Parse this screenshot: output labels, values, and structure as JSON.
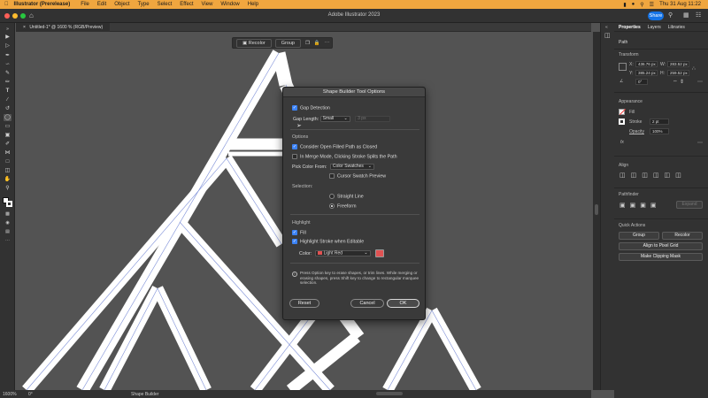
{
  "menubar": {
    "app_name": "Illustrator (Prerelease)",
    "items": [
      "File",
      "Edit",
      "Object",
      "Type",
      "Select",
      "Effect",
      "View",
      "Window",
      "Help"
    ],
    "datetime": "Thu 31 Aug  11:22"
  },
  "window": {
    "title": "Adobe Illustrator 2023",
    "share_label": "Share"
  },
  "document_tab": {
    "label": "Untitled-1* @ 1600 % (RGB/Preview)"
  },
  "context_bar": {
    "recolor_label": "Recolor",
    "group_label": "Group"
  },
  "status_bar": {
    "zoom": "1600%",
    "rotation": "0°",
    "tool": "Shape Builder"
  },
  "right_panel": {
    "tabs": [
      "Properties",
      "Layers",
      "Libraries"
    ],
    "selection_type": "Path",
    "transform": {
      "title": "Transform",
      "x_label": "X:",
      "x": "436.76 px",
      "y_label": "Y:",
      "y": "385.24 px",
      "w_label": "W:",
      "w": "283.52 px",
      "h_label": "H:",
      "h": "259.52 px",
      "angle": "0°"
    },
    "appearance": {
      "title": "Appearance",
      "fill_label": "Fill",
      "stroke_label": "Stroke",
      "stroke_weight": "2 pt",
      "opacity_label": "Opacity",
      "opacity_value": "100%",
      "fx_label": "fx"
    },
    "align": {
      "title": "Align"
    },
    "pathfinder": {
      "title": "Pathfinder",
      "expand_label": "Expand"
    },
    "quick_actions": {
      "title": "Quick Actions",
      "group_label": "Group",
      "recolor_label": "Recolor",
      "align_pixel_label": "Align to Pixel Grid",
      "clipping_mask_label": "Make Clipping Mask"
    }
  },
  "dialog": {
    "title": "Shape Builder Tool Options",
    "gap_detection_label": "Gap Detection",
    "gap_detection_checked": true,
    "gap_length_label": "Gap Length:",
    "gap_length_value": "Small",
    "gap_length_field": "3 px",
    "options_heading": "Options",
    "consider_open_label": "Consider Open Filled Path as Closed",
    "consider_open_checked": true,
    "merge_mode_label": "In Merge Mode, Clicking Stroke Splits the Path",
    "merge_mode_checked": false,
    "pick_color_label": "Pick Color From:",
    "pick_color_value": "Color Swatches",
    "cursor_preview_label": "Cursor Swatch Preview",
    "cursor_preview_checked": false,
    "selection_heading": "Selection:",
    "straight_line_label": "Straight Line",
    "freeform_label": "Freeform",
    "selection_value": "Freeform",
    "highlight_heading": "Highlight",
    "fill_label": "Fill",
    "fill_checked": true,
    "highlight_stroke_label": "Highlight Stroke when Editable",
    "highlight_stroke_checked": true,
    "color_label": "Color:",
    "color_value": "Light Red",
    "highlight_color": "#e05252",
    "info_text": "Press Option key to erase shapes, or trim lines. While merging or erasing shapes, press Shift key to change to rectangular marquee selection.",
    "reset_label": "Reset",
    "cancel_label": "Cancel",
    "ok_label": "OK"
  },
  "colors": {
    "menubar": "#f0a63f",
    "share_button": "#1473e6",
    "accent": "#3b82f6"
  }
}
